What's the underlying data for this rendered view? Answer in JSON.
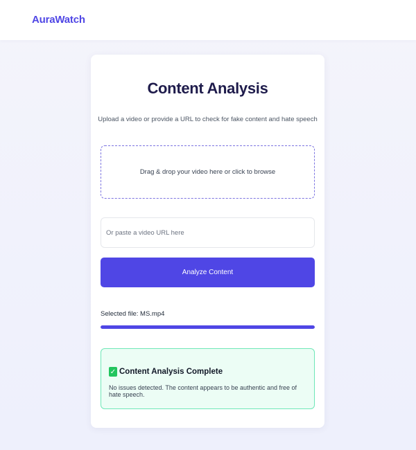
{
  "app": {
    "brand": "AuraWatch"
  },
  "colors": {
    "accent": "#4f46e5",
    "success_bg": "#ecfdf5",
    "success_border": "#6ee7b7"
  },
  "card": {
    "title": "Content Analysis",
    "subtitle": "Upload a video or provide a URL to check for fake content and hate speech"
  },
  "upload": {
    "dropzone_text": "Drag & drop your video here or click to browse"
  },
  "url_input": {
    "value": "",
    "placeholder": "Or paste a video URL here"
  },
  "analyze_button": {
    "label": "Analyze Content"
  },
  "file": {
    "selected_text": "Selected file: MS.mp4"
  },
  "progress": {
    "percent": 100
  },
  "result": {
    "icon": "check-icon",
    "title": "Content Analysis Complete",
    "message": "No issues detected. The content appears to be authentic and free of hate speech."
  }
}
